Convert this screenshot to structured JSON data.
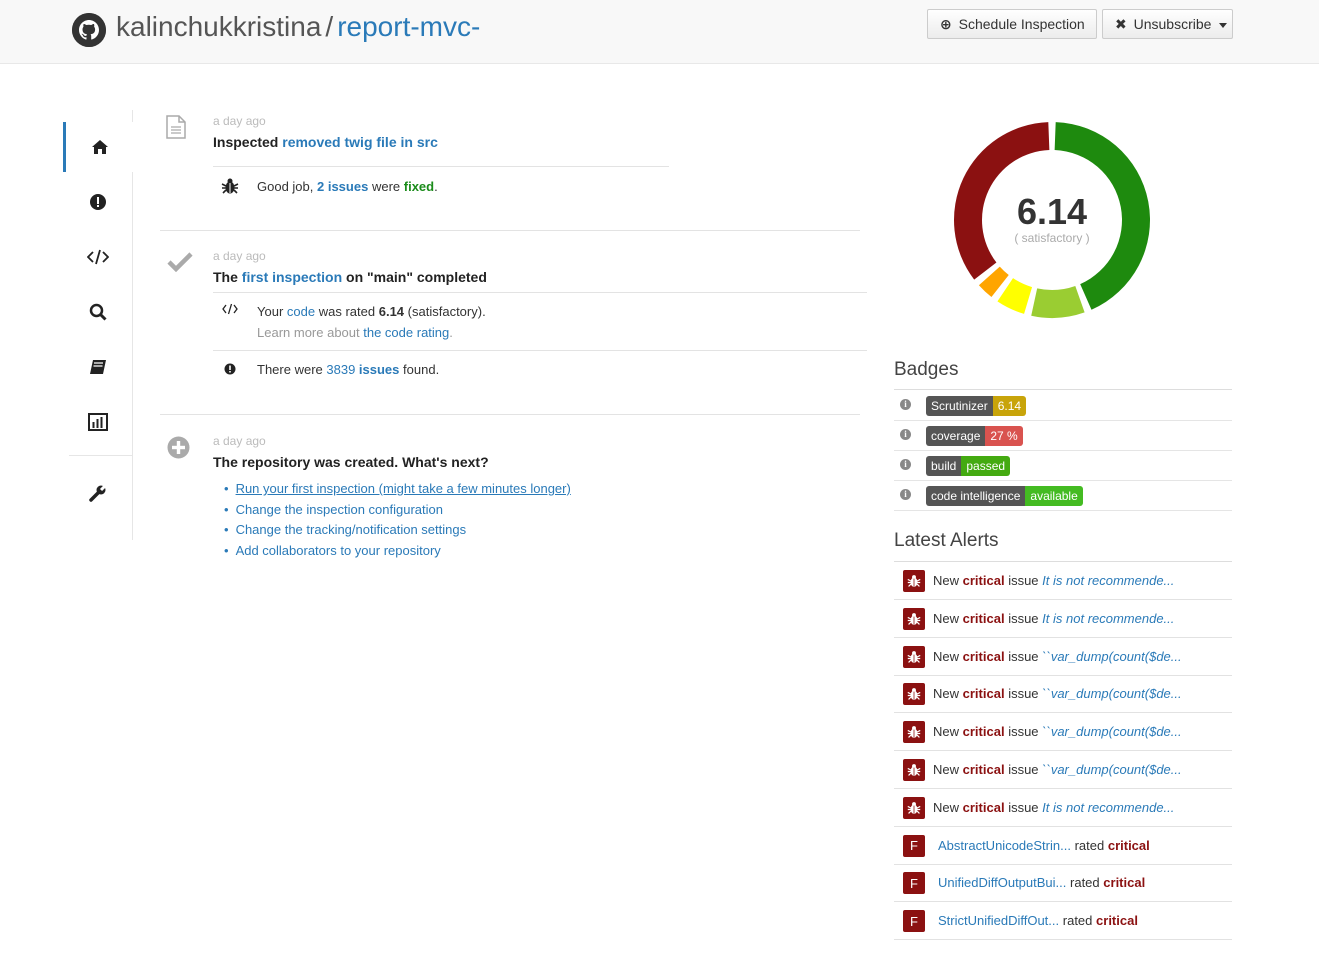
{
  "header": {
    "owner": "kalinchukkristina",
    "separator": "/",
    "repo": "report-mvc-",
    "schedule_button": "Schedule Inspection",
    "unsubscribe_button": "Unsubscribe"
  },
  "sidenav": {
    "items": [
      "home-icon",
      "alert-icon",
      "code-icon",
      "search-icon",
      "book-icon",
      "chart-icon",
      "wrench-icon"
    ],
    "active": "home-icon"
  },
  "events": {
    "e1": {
      "time": "a day ago",
      "title_prefix": "Inspected",
      "title_link": "removed twig file in src",
      "sub_prefix": "Good job,",
      "sub_issues": "2 issues",
      "sub_mid": "were",
      "sub_fixed": "fixed",
      "sub_end": "."
    },
    "e2": {
      "time": "a day ago",
      "title_the": "The",
      "title_link": "first inspection",
      "title_rest": "on \"main\" completed",
      "rated_prefix": "Your",
      "rated_code": "code",
      "rated_mid": "was rated",
      "rated_value": "6.14",
      "rated_suffix": "(satisfactory).",
      "learn_prefix": "Learn more about",
      "learn_link": "the code rating",
      "learn_end": ".",
      "issues_prefix": "There were",
      "issues_count": "3839",
      "issues_word": "issues",
      "issues_suffix": "found."
    },
    "e3": {
      "time": "a day ago",
      "title": "The repository was created. What's next?",
      "todos": [
        "Run your first inspection (might take a few minutes longer)",
        "Change the inspection configuration",
        "Change the tracking/notification settings",
        "Add collaborators to your repository"
      ]
    }
  },
  "rating": {
    "score": "6.14",
    "label": "( satisfactory )",
    "segments": [
      {
        "grade": "very good",
        "color": "#1e8a0e",
        "share": 0.44
      },
      {
        "grade": "good",
        "color": "#9acd32",
        "share": 0.1
      },
      {
        "grade": "satisfactory",
        "color": "#ffff00",
        "share": 0.06
      },
      {
        "grade": "pass",
        "color": "#ffa500",
        "share": 0.04
      },
      {
        "grade": "critical",
        "color": "#8b1111",
        "share": 0.36
      }
    ]
  },
  "badges": {
    "title": "Badges",
    "items": [
      {
        "left": "Scrutinizer",
        "right": "6.14",
        "color": "#c8a40a"
      },
      {
        "left": "coverage",
        "right": "27 %",
        "color": "#d9534f"
      },
      {
        "left": "build",
        "right": "passed",
        "color": "#44aa11"
      },
      {
        "left": "code intelligence",
        "right": "available",
        "color": "#44bb22"
      }
    ]
  },
  "alerts": {
    "title": "Latest Alerts",
    "issue_word_new": "New",
    "issue_word_critical": "critical",
    "issue_word_issue": "issue",
    "rated_word": "rated",
    "issues": [
      "It is not recommende...",
      "It is not recommende...",
      "``var_dump(count($de...",
      "``var_dump(count($de...",
      "``var_dump(count($de...",
      "``var_dump(count($de...",
      "It is not recommende..."
    ],
    "files": [
      {
        "badge": "F",
        "name": "AbstractUnicodeStrin..."
      },
      {
        "badge": "F",
        "name": "UnifiedDiffOutputBui..."
      },
      {
        "badge": "F",
        "name": "StrictUnifiedDiffOut..."
      }
    ]
  }
}
